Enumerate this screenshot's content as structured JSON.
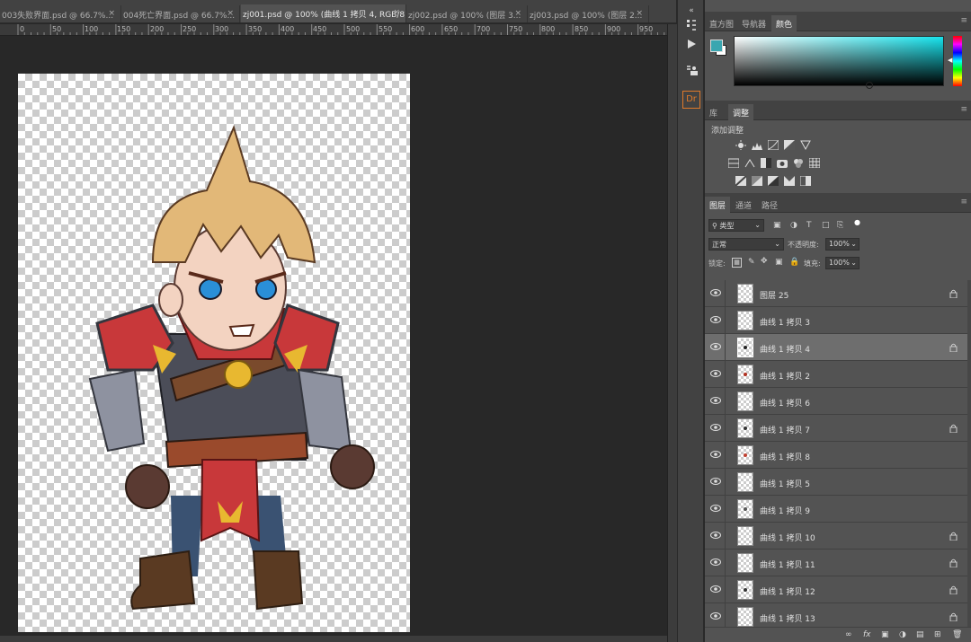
{
  "document_tabs": [
    {
      "label": "003失败界面.psd @ 66.7%...",
      "close": "×",
      "active": false
    },
    {
      "label": "004死亡界面.psd @ 66.7%...",
      "close": "×",
      "active": false
    },
    {
      "label": "zj001.psd @ 100% (曲线 1 拷贝 4, RGB/8)",
      "close": "×",
      "active": true
    },
    {
      "label": "zj002.psd @ 100% (图层 3...",
      "close": "×",
      "active": false
    },
    {
      "label": "zj003.psd @ 100% (图层 2...",
      "close": "×",
      "active": false
    }
  ],
  "ruler_labels": [
    "0",
    "50",
    "100",
    "150",
    "200",
    "250",
    "300",
    "350",
    "400",
    "450",
    "500",
    "550",
    "600",
    "650",
    "700",
    "750",
    "800",
    "850",
    "900",
    "950"
  ],
  "dock": {
    "collapse": "«",
    "items": [
      {
        "icon": "history-icon"
      },
      {
        "icon": "play-actions-icon"
      },
      {
        "icon": "paragraph-styles-icon"
      },
      {
        "icon": "dr-plugin-icon",
        "label": "Dr"
      }
    ]
  },
  "color_panel": {
    "tabs": [
      "直方图",
      "导航器",
      "颜色"
    ],
    "active_tab": "颜色",
    "menu": "≡",
    "foreground_color": "#3aa6b0",
    "background_color": "#ffffff",
    "field_hue": "#17e3ed"
  },
  "adjustments_panel": {
    "tabs": [
      "库",
      "调整"
    ],
    "active_tab": "调整",
    "menu": "≡",
    "title": "添加调整"
  },
  "layers_panel": {
    "tabs": [
      "图层",
      "通道",
      "路径"
    ],
    "active_tab": "图层",
    "menu": "≡",
    "filter_kind": "类型",
    "blend_mode": "正常",
    "opacity_label": "不透明度:",
    "opacity_value": "100%",
    "lock_label": "锁定:",
    "fill_label": "填充:",
    "fill_value": "100%",
    "layers": [
      {
        "name": "图层 25",
        "locked": true,
        "selected": false,
        "thumb_dot": ""
      },
      {
        "name": "曲线 1 拷贝 3",
        "locked": false,
        "selected": false,
        "thumb_dot": ""
      },
      {
        "name": "曲线 1 拷贝 4",
        "locked": true,
        "selected": true,
        "thumb_dot": "#222"
      },
      {
        "name": "曲线 1 拷贝 2",
        "locked": false,
        "selected": false,
        "thumb_dot": "#b03020"
      },
      {
        "name": "曲线 1 拷贝 6",
        "locked": false,
        "selected": false,
        "thumb_dot": ""
      },
      {
        "name": "曲线 1 拷贝 7",
        "locked": true,
        "selected": false,
        "thumb_dot": "#333"
      },
      {
        "name": "曲线 1 拷贝 8",
        "locked": false,
        "selected": false,
        "thumb_dot": "#c04030"
      },
      {
        "name": "曲线 1 拷贝 5",
        "locked": false,
        "selected": false,
        "thumb_dot": ""
      },
      {
        "name": "曲线 1 拷贝 9",
        "locked": false,
        "selected": false,
        "thumb_dot": "#555"
      },
      {
        "name": "曲线 1 拷贝 10",
        "locked": true,
        "selected": false,
        "thumb_dot": ""
      },
      {
        "name": "曲线 1 拷贝 11",
        "locked": true,
        "selected": false,
        "thumb_dot": ""
      },
      {
        "name": "曲线 1 拷贝 12",
        "locked": true,
        "selected": false,
        "thumb_dot": "#333"
      },
      {
        "name": "曲线 1 拷贝 13",
        "locked": true,
        "selected": false,
        "thumb_dot": ""
      }
    ],
    "footer": [
      "link-layers-icon",
      "fx-icon",
      "add-mask-icon",
      "new-adjustment-icon",
      "new-group-icon",
      "new-layer-icon",
      "delete-layer-icon"
    ],
    "footer_fx": "fx"
  },
  "colors": {
    "app_bg": "#282828",
    "panel_bg": "#535353",
    "selected_row": "#6e6e6e",
    "armor_red": "#c8383a",
    "hair": "#e2b878",
    "eye_blue": "#2a8fd8"
  }
}
